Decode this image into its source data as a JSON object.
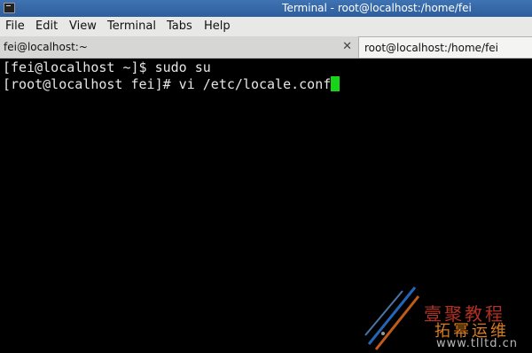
{
  "window": {
    "title": "Terminal - root@localhost:/home/fei",
    "icon": "terminal-icon"
  },
  "menubar": {
    "items": [
      "File",
      "Edit",
      "View",
      "Terminal",
      "Tabs",
      "Help"
    ]
  },
  "tabs": [
    {
      "label": "fei@localhost:~",
      "active": false
    },
    {
      "label": "root@localhost:/home/fei",
      "active": true
    }
  ],
  "tab_close_icon": "close-icon",
  "terminal": {
    "lines": [
      "[fei@localhost ~]$ sudo su",
      "[root@localhost fei]# vi /etc/locale.conf"
    ],
    "cursor_color": "#18d418"
  },
  "watermark": {
    "line1": "壹聚教程",
    "line2": "拓幂运维",
    "line3": "www.tlltd.cn"
  },
  "colors": {
    "titlebar": "#3f73b3",
    "terminal_bg": "#000000",
    "terminal_fg": "#e6e6e6"
  }
}
